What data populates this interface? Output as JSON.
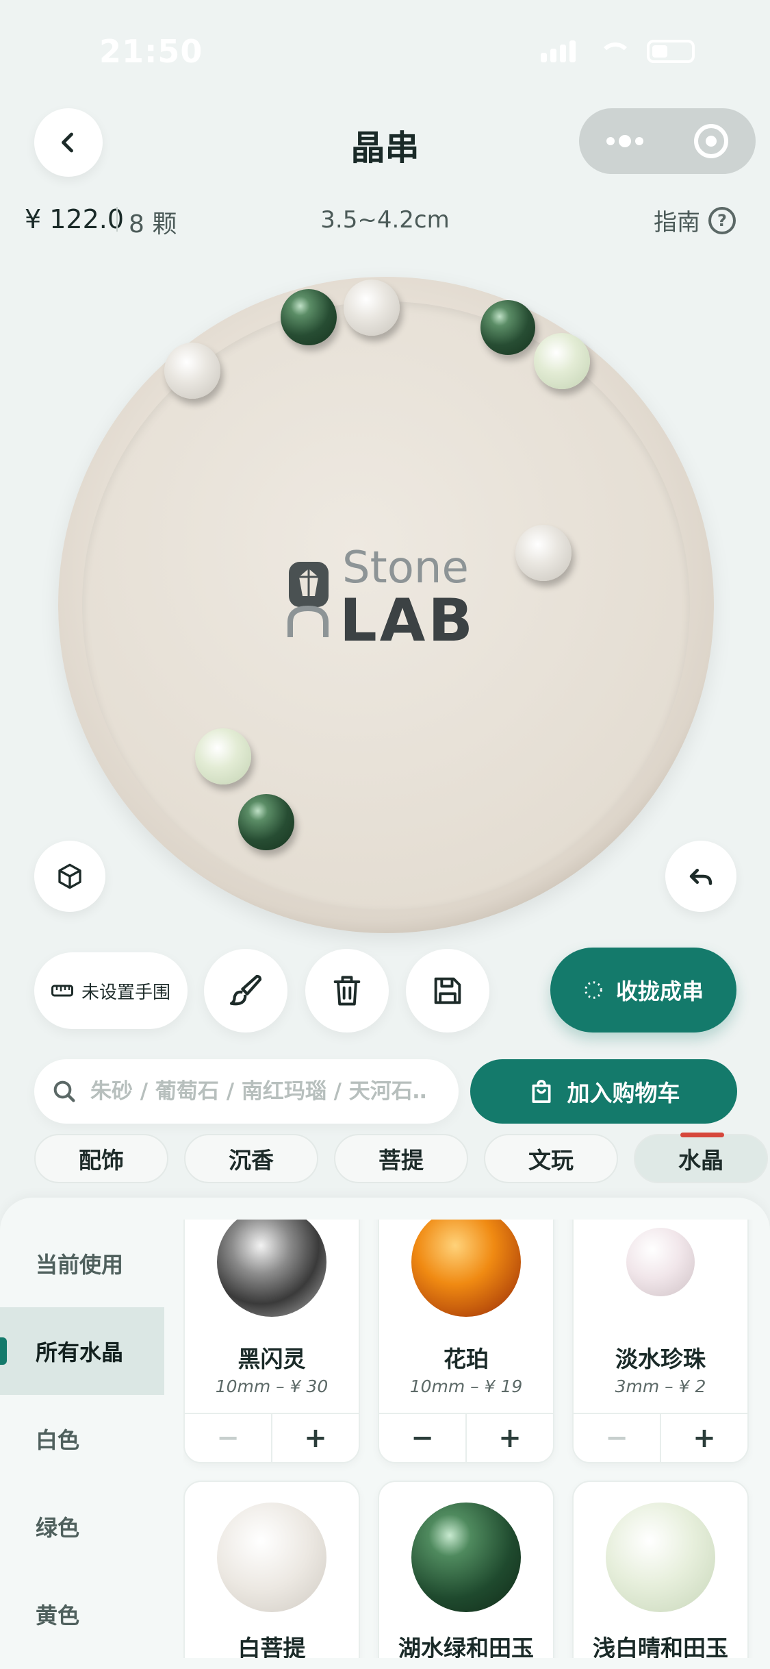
{
  "status": {
    "time": "21:50"
  },
  "header": {
    "title": "晶串",
    "back_icon": "chevron-left-icon",
    "more_icon": "more-dots-icon",
    "close_icon": "target-icon"
  },
  "info": {
    "price": "¥ 122.0",
    "count": "8 颗",
    "size": "3.5~4.2cm",
    "guide": "指南"
  },
  "plate": {
    "logo_top": "Stone",
    "logo_bottom": "LAB"
  },
  "actions": {
    "wrist_label": "未设置手围",
    "collect_label": "收拢成串"
  },
  "search": {
    "placeholder": "朱砂 / 葡萄石 / 南红玛瑙 / 天河石…",
    "cart_label": "加入购物车"
  },
  "tabs": [
    {
      "label": "配饰",
      "active": false
    },
    {
      "label": "沉香",
      "active": false
    },
    {
      "label": "菩提",
      "active": false
    },
    {
      "label": "文玩",
      "active": false
    },
    {
      "label": "水晶",
      "active": true
    }
  ],
  "sidebar": [
    {
      "label": "当前使用",
      "active": false
    },
    {
      "label": "所有水晶",
      "active": true
    },
    {
      "label": "白色",
      "active": false
    },
    {
      "label": "绿色",
      "active": false
    },
    {
      "label": "黄色",
      "active": false
    }
  ],
  "products": [
    {
      "name": "黑闪灵",
      "meta": "10mm – ¥ 30",
      "minus_disabled": true
    },
    {
      "name": "花珀",
      "meta": "10mm – ¥ 19",
      "minus_disabled": false
    },
    {
      "name": "淡水珍珠",
      "meta": "3mm – ¥ 2",
      "minus_disabled": true
    },
    {
      "name": "白菩提",
      "meta": "",
      "minus_disabled": false
    },
    {
      "name": "湖水绿和田玉",
      "meta": "",
      "minus_disabled": false
    },
    {
      "name": "浅白晴和田玉",
      "meta": "",
      "minus_disabled": false
    }
  ],
  "stepper": {
    "minus": "−",
    "plus": "+"
  },
  "colors": {
    "accent": "#147a6b",
    "tab_marker": "#d6473b"
  }
}
